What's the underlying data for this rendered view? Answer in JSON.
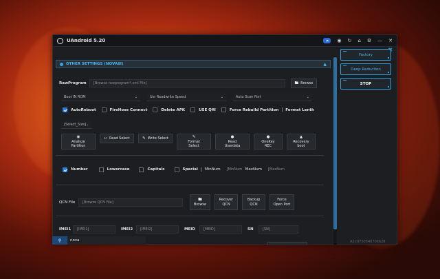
{
  "window": {
    "title": "UAndroid 5.20",
    "titlebar_badge": "",
    "titlebar_icons": [
      "cloud-badge-icon",
      "globe-icon",
      "sync-icon",
      "home-icon",
      "gear-icon",
      "minimize-icon",
      "close-icon"
    ]
  },
  "section": {
    "title": "OTHER SETTINGS (NOVA8I)"
  },
  "rawprogram": {
    "label": "RawProgram",
    "placeholder": "[Browse rawprogram*.xml File]",
    "browse_label": "Browse"
  },
  "selects": {
    "boot_mode": "Boot IN ROM",
    "speed": "Usr Readwrite Speed",
    "port": "Auto Scan Port",
    "size": "[Select_Size]"
  },
  "options": {
    "autoreboot": "AutoReboot",
    "firehose": "FireHose Connect",
    "delete_apk": "Delete APK",
    "use_qfil": "USE Qfil",
    "force_rebuild": "Force Rebuild Partition",
    "format_length": "Format Lenth"
  },
  "actions": {
    "analyze": [
      "Analyze",
      "Partition"
    ],
    "read_select": "Read Select",
    "write_select": "Write Select",
    "format_select": [
      "Format",
      "Select"
    ],
    "read_userdata": [
      "Read",
      "Userdata"
    ],
    "onekey_rec": [
      "OneKey",
      "REC"
    ],
    "recovery_boot": [
      "Recovery",
      "boot"
    ]
  },
  "generator": {
    "number": "Number",
    "lowercase": "Lowercase",
    "capitals": "Capitals",
    "special": "Special",
    "minnum_label": "MinNum",
    "minnum_placeholder": "[MinNum",
    "maxnum_label": "MaxNum",
    "maxnum_placeholder": "[MaxNum"
  },
  "qcn": {
    "label": "QCN File",
    "placeholder": "[Browse QCN File]",
    "browse": "Browse",
    "recover": [
      "Recover",
      "QCN"
    ],
    "backup": [
      "Backup",
      "QCN"
    ],
    "force_open": [
      "Force",
      "Open Port"
    ]
  },
  "imei": {
    "imei1_label": "IMEI1",
    "imei1_ph": "[IMEI1]",
    "imei2_label": "IMEI2",
    "imei2_ph": "[IMEI2]",
    "meid_label": "MEID",
    "meid_ph": "[MEID]",
    "sn_label": "SN",
    "sn_ph": "[SN]"
  },
  "right_panel": {
    "factory": "Factory",
    "deep_reduction": "Deep Reduction",
    "stop": "STOP"
  },
  "serial": "A2C9750540706628",
  "search": {
    "value": "nova"
  },
  "colors": {
    "accent": "#3aa6e0",
    "window_bg": "#1c1e22",
    "checkbox_on": "#2a7ae0"
  }
}
